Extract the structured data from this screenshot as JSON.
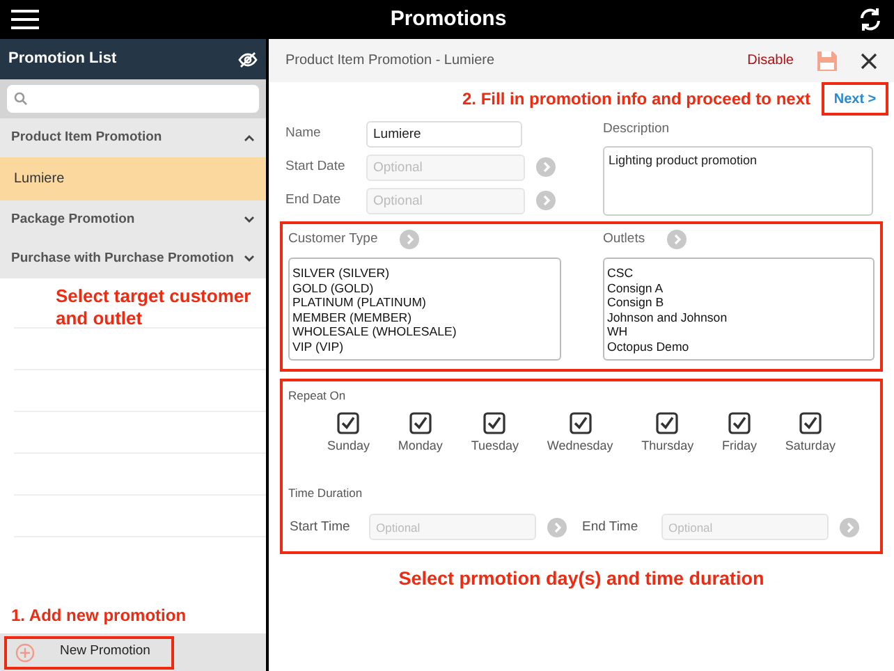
{
  "top_bar": {
    "title": "Promotions"
  },
  "sidebar": {
    "title": "Promotion List",
    "groups": [
      {
        "label": "Product Item Promotion",
        "expanded": true,
        "children": [
          {
            "label": "Lumiere",
            "selected": true
          }
        ]
      },
      {
        "label": "Package Promotion",
        "expanded": false
      },
      {
        "label": "Purchase with Purchase Promotion",
        "expanded": false
      }
    ],
    "annotation_target": "Select target customer and outlet",
    "annotation_add": "1. Add new promotion",
    "new_button": "New Promotion"
  },
  "detail": {
    "title": "Product Item Promotion - Lumiere",
    "disable": "Disable",
    "annotation_fill": "2. Fill in promotion info and proceed to next",
    "next": "Next >",
    "fields": [
      {
        "kind": "text",
        "label": "Name",
        "value": "Lumiere"
      },
      {
        "kind": "picker",
        "label": "Start Date",
        "placeholder": "Optional"
      },
      {
        "kind": "picker",
        "label": "End Date",
        "placeholder": "Optional"
      }
    ],
    "description": {
      "label": "Description",
      "value": "Lighting product promotion"
    },
    "customer_type": {
      "label": "Customer Type",
      "items": [
        "SILVER (SILVER)",
        "GOLD (GOLD)",
        "PLATINUM (PLATINUM)",
        "MEMBER (MEMBER)",
        "WHOLESALE (WHOLESALE)",
        "VIP (VIP)"
      ]
    },
    "outlets": {
      "label": "Outlets",
      "items": [
        "CSC",
        "Consign A",
        "Consign B",
        "Johnson and Johnson",
        "WH",
        "Octopus Demo"
      ]
    },
    "repeat_on": {
      "label": "Repeat On",
      "days": [
        {
          "label": "Sunday",
          "checked": true
        },
        {
          "label": "Monday",
          "checked": true
        },
        {
          "label": "Tuesday",
          "checked": true
        },
        {
          "label": "Wednesday",
          "checked": true
        },
        {
          "label": "Thursday",
          "checked": true
        },
        {
          "label": "Friday",
          "checked": true
        },
        {
          "label": "Saturday",
          "checked": true
        }
      ]
    },
    "time_duration": {
      "label": "Time Duration",
      "start": {
        "label": "Start Time",
        "placeholder": "Optional"
      },
      "end": {
        "label": "End Time",
        "placeholder": "Optional"
      }
    },
    "annotation_days": "Select prmotion day(s) and time duration"
  }
}
